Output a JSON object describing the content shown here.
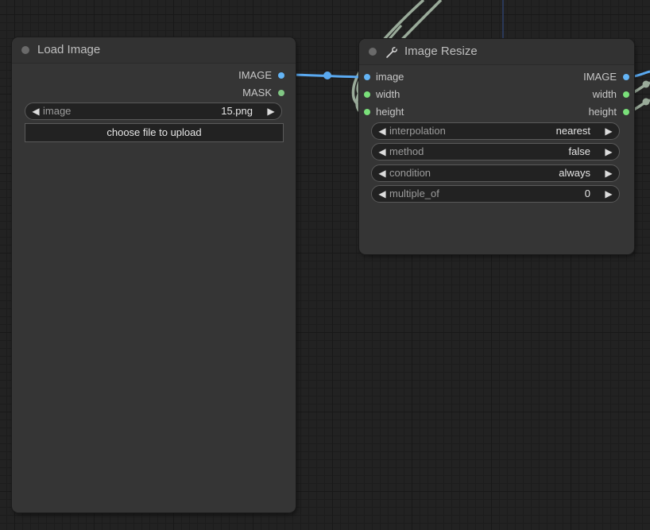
{
  "nodes": {
    "load_image": {
      "title": "Load Image",
      "outputs": [
        {
          "label": "IMAGE",
          "color": "#64b5f6"
        },
        {
          "label": "MASK",
          "color": "#81c784"
        }
      ],
      "widgets": {
        "image": {
          "label": "image",
          "value": "15.png"
        },
        "upload_label": "choose file to upload"
      }
    },
    "image_resize": {
      "title": "Image Resize",
      "inputs": [
        {
          "label": "image",
          "color": "#64b5f6"
        },
        {
          "label": "width",
          "color": "#7ae07a"
        },
        {
          "label": "height",
          "color": "#7ae07a"
        }
      ],
      "outputs": [
        {
          "label": "IMAGE",
          "color": "#64b5f6"
        },
        {
          "label": "width",
          "color": "#7ae07a"
        },
        {
          "label": "height",
          "color": "#7ae07a"
        }
      ],
      "widgets": [
        {
          "label": "interpolation",
          "value": "nearest"
        },
        {
          "label": "method",
          "value": "false"
        },
        {
          "label": "condition",
          "value": "always"
        },
        {
          "label": "multiple_of",
          "value": "0"
        }
      ]
    }
  },
  "colors": {
    "image_link": "#5aa9f0",
    "int_link": "#9aab9a",
    "image_slot": "#64b5f6",
    "int_slot": "#7ae07a"
  }
}
